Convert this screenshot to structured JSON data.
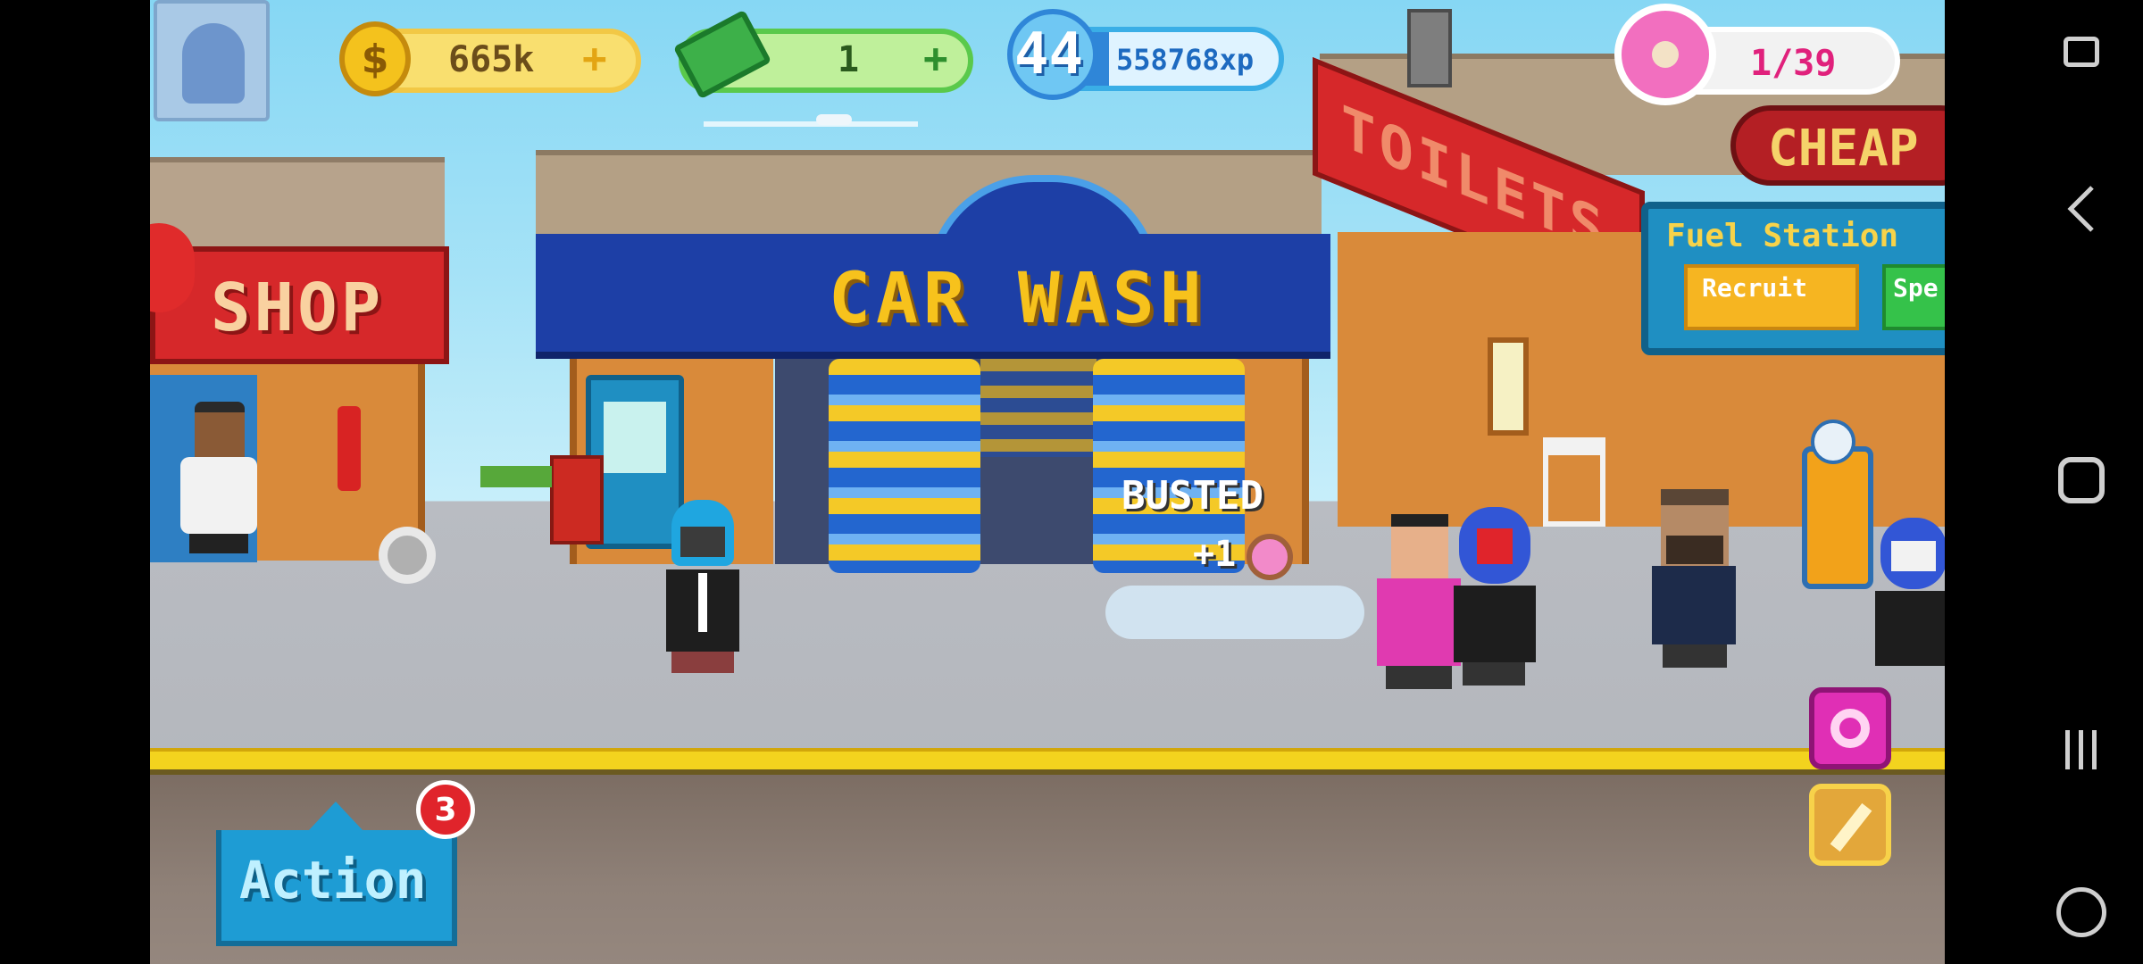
{
  "hud": {
    "coins": "665k",
    "coins_add": "+",
    "cash": "1",
    "cash_add": "+",
    "level": "44",
    "xp": "558768xp",
    "xp_progress": 0.35,
    "donuts": "1/39"
  },
  "signs": {
    "shop": "SHOP",
    "car_wash": "CAR WASH",
    "toilets": "TOILETS",
    "cheap": "CHEAP",
    "fuel_station": "Fuel Station",
    "recruit": "Recruit",
    "spe": "Spe"
  },
  "popup": {
    "busted": "BUSTED",
    "reward": "+1"
  },
  "action": {
    "label": "Action",
    "badge": "3"
  },
  "icons": {
    "coin": "coin-icon",
    "cash": "cash-icon",
    "xp": "xp-plane-icon",
    "donut": "donut-icon",
    "donut_button": "donut-icon",
    "wrench_button": "wrench-icon",
    "speaker": "speaker-icon",
    "nav_recent": "recent-apps-icon",
    "nav_home": "home-icon",
    "nav_back": "back-icon",
    "nav_game": "gamepad-icon",
    "nav_keyboard": "keyboard-icon"
  },
  "colors": {
    "coin_pill": "#f9df6f",
    "cash_pill": "#a6e57a",
    "xp_pill": "#3aaee6",
    "donut_pill": "#f2f2f2",
    "car_wash_roof": "#1d3fa6",
    "sign_yellow": "#f7c21c",
    "shop_red": "#d6282a",
    "action_blue": "#1e9cd4"
  }
}
